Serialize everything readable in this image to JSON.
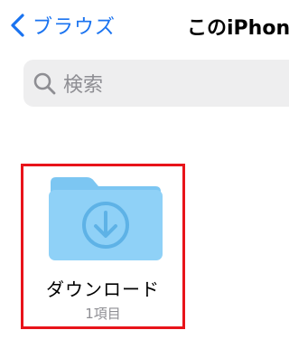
{
  "nav": {
    "back_label": "ブラウズ",
    "title": "このiPhon"
  },
  "search": {
    "placeholder": "検索"
  },
  "folder": {
    "name": "ダウンロード",
    "item_count": "1項目",
    "icon": "download-folder-icon"
  },
  "colors": {
    "accent": "#1a73f0",
    "folder_body": "#8fd1f7",
    "highlight_border": "#e8141a"
  }
}
